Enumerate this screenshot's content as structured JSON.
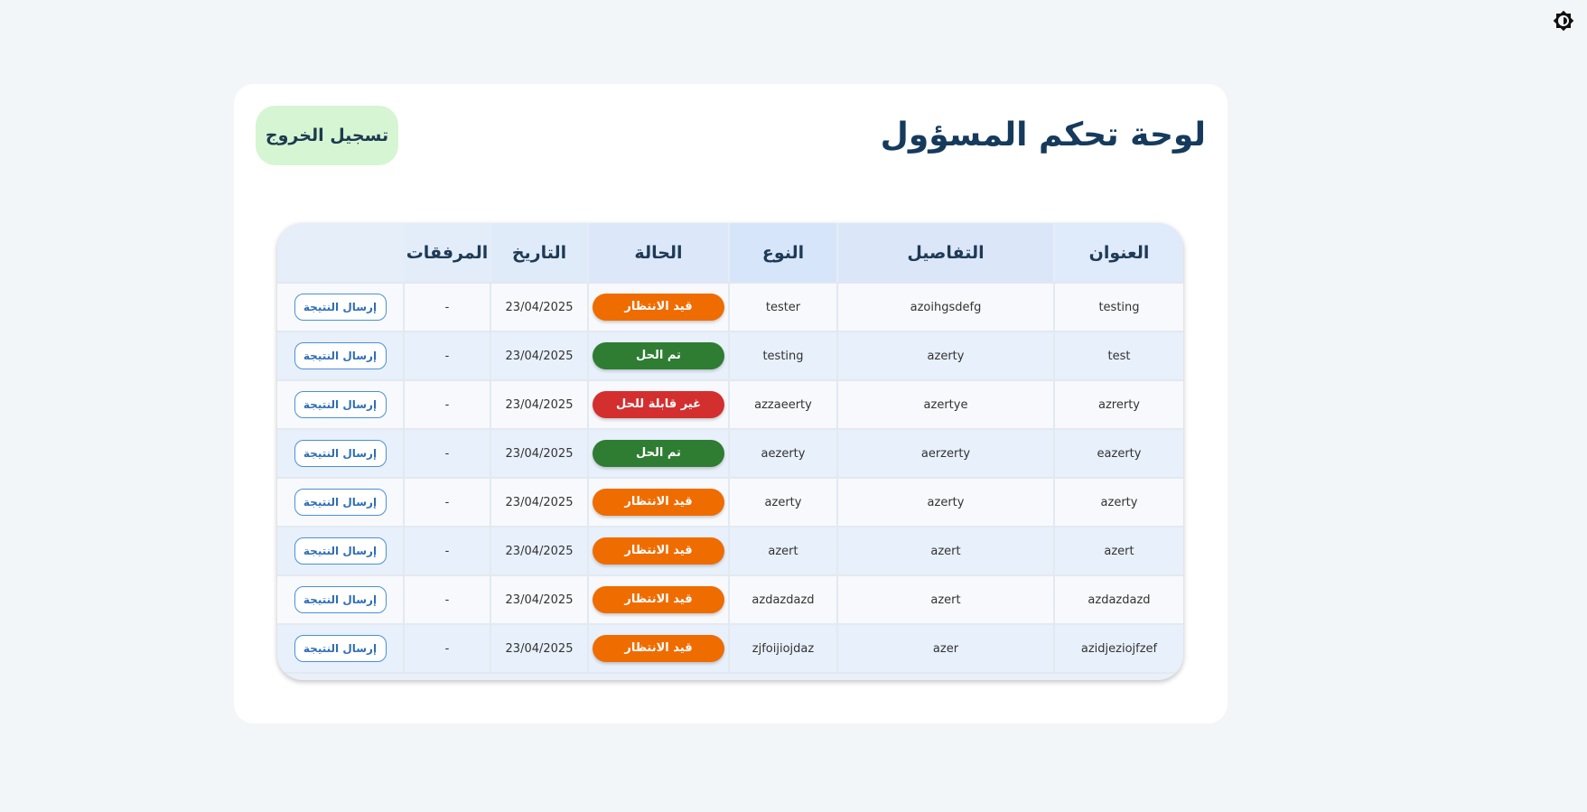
{
  "header": {
    "title": "لوحة تحكم المسؤول",
    "logout_label": "تسجيل الخروج",
    "theme_icon": "brightness-icon"
  },
  "colors": {
    "pending": "#ef6c00",
    "resolved": "#2e7d32",
    "unsolvable": "#d32f2f"
  },
  "table": {
    "columns": {
      "title": "العنوان",
      "details": "التفاصيل",
      "type": "النوع",
      "status": "الحالة",
      "date": "التاريخ",
      "attachments": "المرفقات",
      "action": ""
    },
    "action_label": "إرسال النتيجة",
    "rows": [
      {
        "title": "testing",
        "details": "azoihgsdefg",
        "type": "tester",
        "status": "قيد الانتظار",
        "status_key": "pending",
        "date": "23/04/2025",
        "attachments": "-"
      },
      {
        "title": "test",
        "details": "azerty",
        "type": "testing",
        "status": "تم الحل",
        "status_key": "resolved",
        "date": "23/04/2025",
        "attachments": "-"
      },
      {
        "title": "azrerty",
        "details": "azertye",
        "type": "azzaeerty",
        "status": "غير قابلة للحل",
        "status_key": "unsolvable",
        "date": "23/04/2025",
        "attachments": "-"
      },
      {
        "title": "eazerty",
        "details": "aerzerty",
        "type": "aezerty",
        "status": "تم الحل",
        "status_key": "resolved",
        "date": "23/04/2025",
        "attachments": "-"
      },
      {
        "title": "azerty",
        "details": "azerty",
        "type": "azerty",
        "status": "قيد الانتظار",
        "status_key": "pending",
        "date": "23/04/2025",
        "attachments": "-"
      },
      {
        "title": "azert",
        "details": "azert",
        "type": "azert",
        "status": "قيد الانتظار",
        "status_key": "pending",
        "date": "23/04/2025",
        "attachments": "-"
      },
      {
        "title": "azdazdazd",
        "details": "azert",
        "type": "azdazdazd",
        "status": "قيد الانتظار",
        "status_key": "pending",
        "date": "23/04/2025",
        "attachments": "-"
      },
      {
        "title": "azidjeziojfzef",
        "details": "azer",
        "type": "zjfoijiojdaz",
        "status": "قيد الانتظار",
        "status_key": "pending",
        "date": "23/04/2025",
        "attachments": "-"
      }
    ]
  }
}
